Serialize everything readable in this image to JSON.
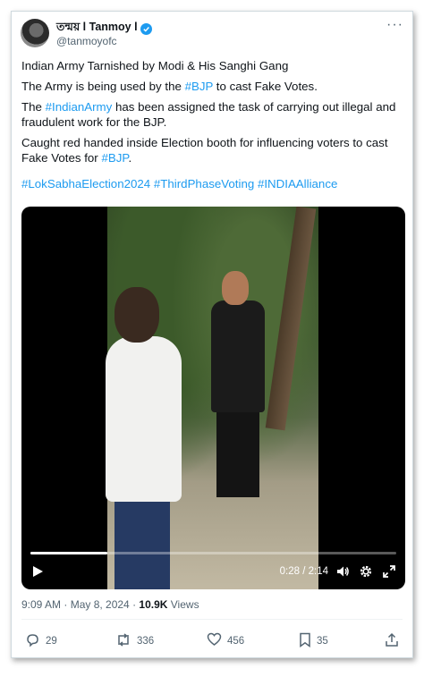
{
  "author": {
    "name": "তন্ময় l Tanmoy l",
    "handle": "@tanmoyofc",
    "verified": true
  },
  "icons": {
    "more": "more-icon",
    "verified": "verified-badge-icon",
    "play": "play-icon",
    "volume": "volume-icon",
    "settings": "gear-icon",
    "fullscreen": "fullscreen-icon",
    "reply": "reply-icon",
    "repost": "repost-icon",
    "like": "heart-icon",
    "bookmark": "bookmark-icon",
    "share": "share-icon"
  },
  "tweet": {
    "p1": "Indian Army Tarnished by Modi & His Sanghi Gang",
    "p2_before": "The Army is being used by the ",
    "p2_tag": "#BJP",
    "p2_after": " to cast Fake Votes.",
    "p3_before": "The ",
    "p3_tag": "#IndianArmy",
    "p3_after": " has been assigned the task of carrying out illegal and fraudulent work for the BJP.",
    "p4_before": "Caught red handed inside Election booth for influencing voters to cast Fake Votes for ",
    "p4_tag": "#BJP",
    "p4_after": ".",
    "hashtags": [
      "#LokSabhaElection2024",
      "#ThirdPhaseVoting",
      "#INDIAAlliance"
    ]
  },
  "video": {
    "time": "0:28 / 2:14",
    "progress": 0.21
  },
  "meta": {
    "time": "9:09 AM · May 8, 2024 · ",
    "views_count": "10.9K",
    "views_label": " Views"
  },
  "actions": {
    "replies": "29",
    "reposts": "336",
    "likes": "456",
    "bookmarks": "35"
  },
  "colors": {
    "accent": "#1d9bf0",
    "text": "#0f1419",
    "muted": "#536471"
  }
}
